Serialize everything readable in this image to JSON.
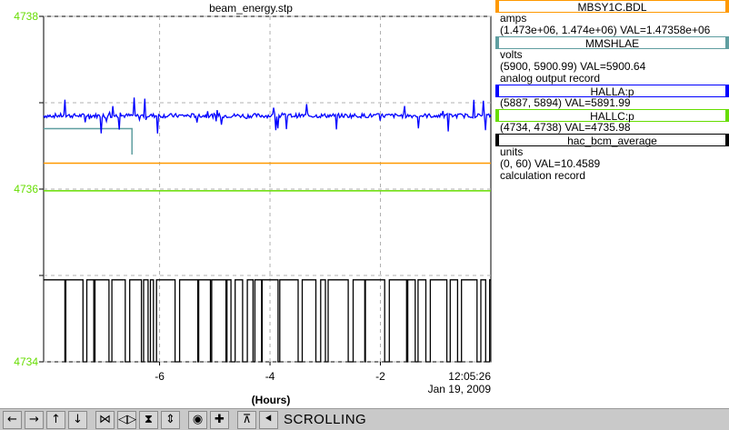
{
  "chart_data": {
    "type": "line",
    "title": "beam_energy.stp",
    "xlabel": "(Hours)",
    "ylabel": "",
    "xlim": [
      -8.1,
      0
    ],
    "ylim": [
      4734,
      4738
    ],
    "x_ticks": [
      -6,
      -4,
      -2
    ],
    "x_tick_labels": [
      "-6",
      "-4",
      "-2"
    ],
    "x_end_label_time": "12:05:26",
    "x_end_label_date": "Jan 19, 2009",
    "y_ticks": [
      4734,
      4735,
      4736,
      4737,
      4738
    ],
    "y_tick_labels": [
      "4734",
      "",
      "4736",
      "",
      "4738"
    ],
    "grid": true,
    "series": [
      {
        "name": "MBSY1C.BDL",
        "color": "#ff9900",
        "x": [
          -8.1,
          0
        ],
        "y": [
          4736.3,
          4736.3
        ]
      },
      {
        "name": "MMSHLAE",
        "color": "#5f9ea0",
        "x": [
          -8.1,
          -6.5,
          -6.5
        ],
        "y": [
          4736.7,
          4736.7,
          4736.4
        ]
      },
      {
        "name": "HALLA:p",
        "color": "#0000ff",
        "x": [
          -8.1,
          0
        ],
        "y": [
          4736.85,
          4736.85
        ]
      },
      {
        "name": "HALLC:p",
        "color": "#66dd00",
        "x": [
          -8.1,
          0
        ],
        "y": [
          4735.98,
          4735.98
        ]
      },
      {
        "name": "hac_bcm_average",
        "color": "#000000",
        "x": [
          -8.1,
          0
        ],
        "y": [
          4734.95,
          4734.95
        ]
      }
    ]
  },
  "legend": [
    {
      "name": "MBSY1C.BDL",
      "color": "#ff9900",
      "lines": [
        "amps",
        "(1.473e+06, 1.474e+06)  VAL=1.47358e+06"
      ]
    },
    {
      "name": "MMSHLAE",
      "color": "#5f9ea0",
      "lines": [
        "volts",
        "(5900, 5900.99) VAL=5900.64",
        "analog output record"
      ]
    },
    {
      "name": "HALLA:p",
      "color": "#0000ff",
      "lines": [
        "(5887, 5894) VAL=5891.99"
      ]
    },
    {
      "name": "HALLC:p",
      "color": "#66dd00",
      "lines": [
        "(4734, 4738) VAL=4735.98"
      ]
    },
    {
      "name": "hac_bcm_average",
      "color": "#000000",
      "lines": [
        "units",
        "(0, 60) VAL=10.4589",
        "calculation record"
      ]
    }
  ],
  "toolbar": {
    "buttons": [
      {
        "name": "pan-left-icon",
        "glyph": "←"
      },
      {
        "name": "pan-right-icon",
        "glyph": "→"
      },
      {
        "name": "pan-up-icon",
        "glyph": "↑"
      },
      {
        "name": "pan-down-icon",
        "glyph": "↓"
      },
      {
        "name": "zoom-x-in-icon",
        "glyph": "⋈"
      },
      {
        "name": "zoom-x-out-icon",
        "glyph": "◁▷"
      },
      {
        "name": "zoom-y-in-icon",
        "glyph": "⧗"
      },
      {
        "name": "zoom-y-out-icon",
        "glyph": "⇕"
      },
      {
        "name": "zoom-in-icon",
        "glyph": "◉"
      },
      {
        "name": "zoom-out-icon",
        "glyph": "✚"
      },
      {
        "name": "autoscale-icon",
        "glyph": "⊼"
      },
      {
        "name": "config-icon",
        "glyph": "⯇"
      }
    ],
    "status": "SCROLLING"
  },
  "colors": {
    "axis_label": "#66dd00",
    "grid": "#b0b0b0"
  }
}
